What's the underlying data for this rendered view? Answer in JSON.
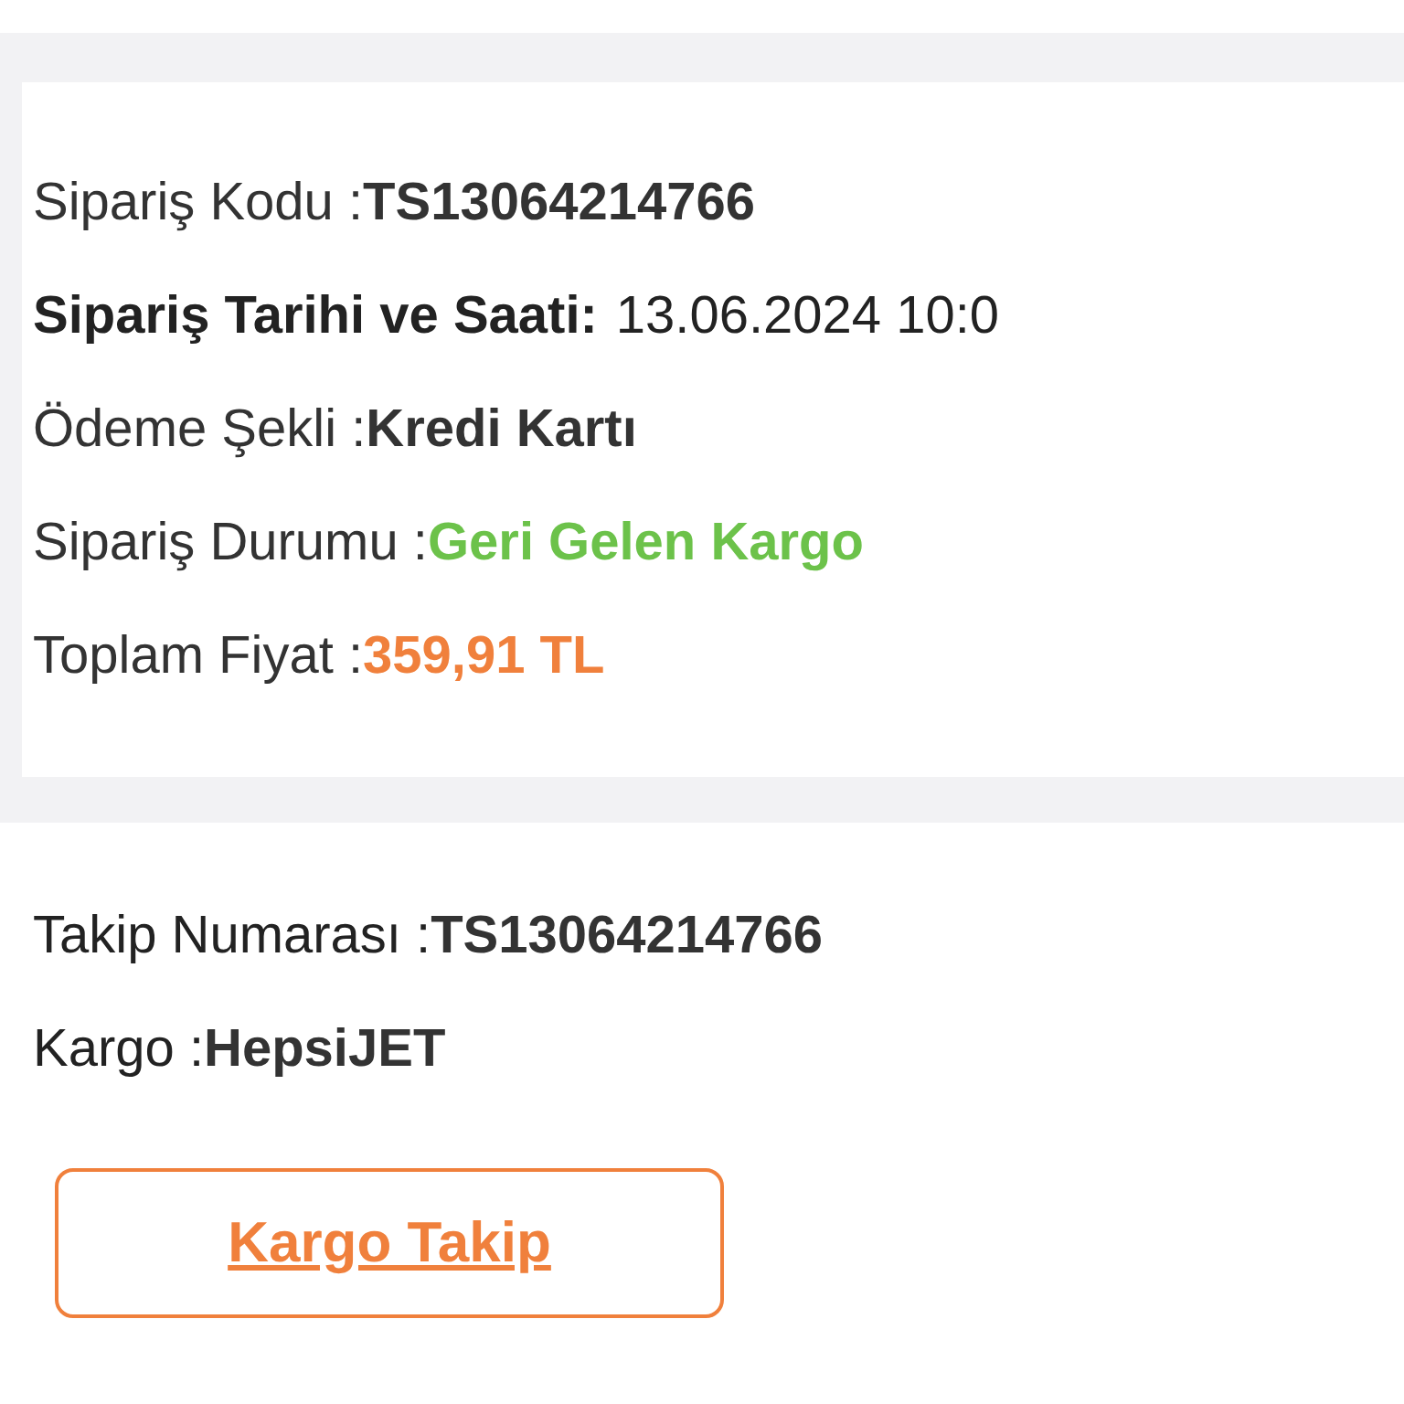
{
  "order_details": [
    {
      "label": "Sipariş Kodu :",
      "value": "TS13064214766",
      "kind": "plain"
    },
    {
      "label": "Sipariş Tarihi ve Saati:",
      "value": "13.06.2024 10:0",
      "kind": "emphasis"
    },
    {
      "label": "Ödeme Şekli :",
      "value": "Kredi Kartı",
      "kind": "plain"
    },
    {
      "label": "Sipariş Durumu :",
      "value": "Geri Gelen Kargo",
      "kind": "status"
    },
    {
      "label": "Toplam Fiyat :",
      "value": "359,91 TL",
      "kind": "price"
    }
  ],
  "shipping": [
    {
      "label": "Takip Numarası :",
      "value": "TS13064214766"
    },
    {
      "label": "Kargo :",
      "value": "HepsiJET"
    }
  ],
  "track_button": {
    "label": "Kargo Takip"
  }
}
